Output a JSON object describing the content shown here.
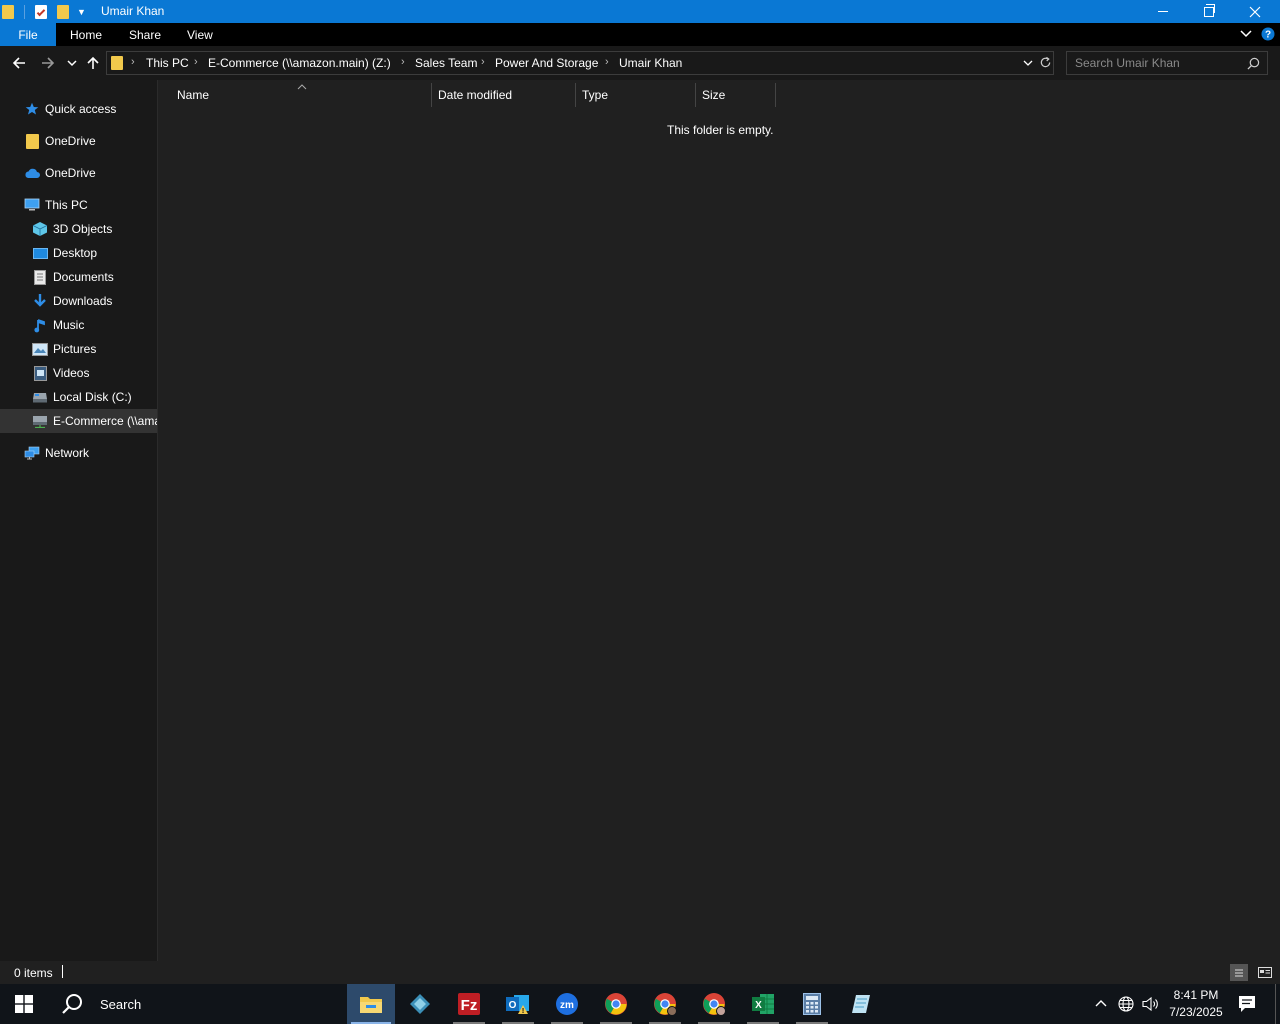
{
  "window": {
    "title": "Umair Khan",
    "minimize_label": "Minimize",
    "restore_label": "Restore",
    "close_label": "Close"
  },
  "ribbon": {
    "file": "File",
    "home": "Home",
    "share": "Share",
    "view": "View"
  },
  "address": {
    "crumbs": [
      "This PC",
      "E-Commerce (\\\\amazon.main) (Z:)",
      "Sales Team",
      "Power And Storage",
      "Umair Khan"
    ]
  },
  "search": {
    "placeholder": "Search Umair Khan"
  },
  "sidebar": {
    "items": [
      {
        "label": "Quick access",
        "icon": "star-icon"
      },
      {
        "label": "OneDrive",
        "icon": "folder-icon"
      },
      {
        "label": "OneDrive",
        "icon": "cloud-icon"
      },
      {
        "label": "This PC",
        "icon": "computer-icon"
      },
      {
        "label": "3D Objects",
        "icon": "cube-icon"
      },
      {
        "label": "Desktop",
        "icon": "desktop-icon"
      },
      {
        "label": "Documents",
        "icon": "document-icon"
      },
      {
        "label": "Downloads",
        "icon": "download-icon"
      },
      {
        "label": "Music",
        "icon": "music-icon"
      },
      {
        "label": "Pictures",
        "icon": "pictures-icon"
      },
      {
        "label": "Videos",
        "icon": "video-icon"
      },
      {
        "label": "Local Disk (C:)",
        "icon": "disk-icon"
      },
      {
        "label": "E-Commerce (\\\\amazon.main) (Z:)",
        "icon": "network-drive-icon"
      },
      {
        "label": "Network",
        "icon": "network-icon"
      }
    ]
  },
  "columns": {
    "name": "Name",
    "date_modified": "Date modified",
    "type": "Type",
    "size": "Size"
  },
  "content": {
    "empty_message": "This folder is empty."
  },
  "status": {
    "items": "0 items"
  },
  "taskbar": {
    "search_label": "Search",
    "time": "8:41 PM",
    "date": "7/23/2025"
  },
  "colors": {
    "accent": "#0a78d4",
    "background": "#202020",
    "sidebar": "#191919"
  }
}
